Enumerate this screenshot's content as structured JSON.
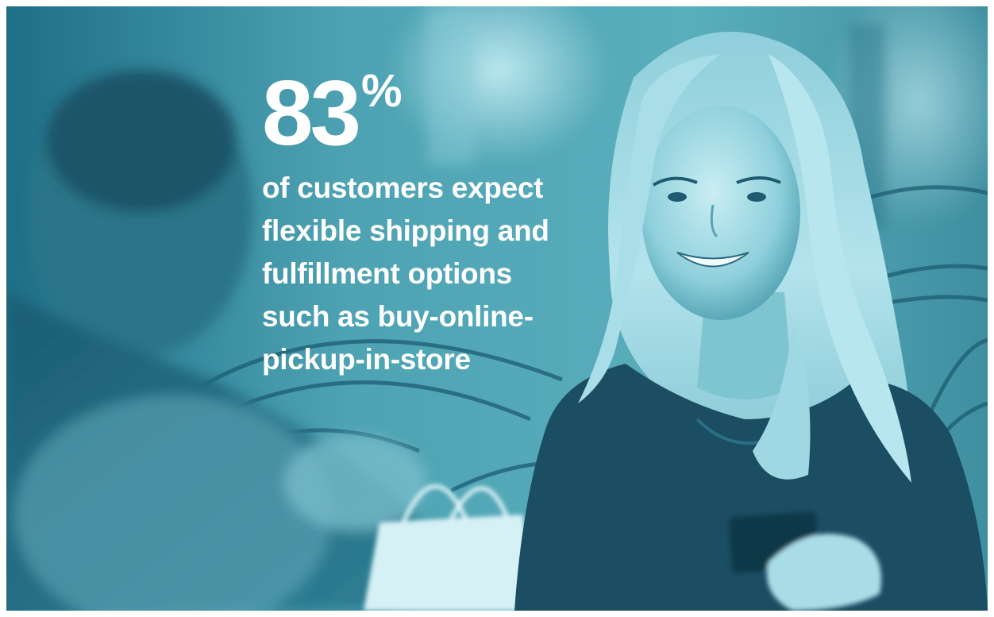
{
  "colors": {
    "duotone_base": "#3f8fa0",
    "duotone_dark": "#123f55",
    "duotone_light": "#9fdbe6",
    "text": "#ffffff"
  },
  "icons": {
    "arc_pattern": "decorative-arc-lines-icon"
  },
  "stat": {
    "value": "83",
    "unit": "%",
    "caption_lines": [
      "of customers expect",
      "flexible shipping and",
      "fulfillment options",
      "such as buy-online-",
      "pickup-in-store"
    ]
  }
}
